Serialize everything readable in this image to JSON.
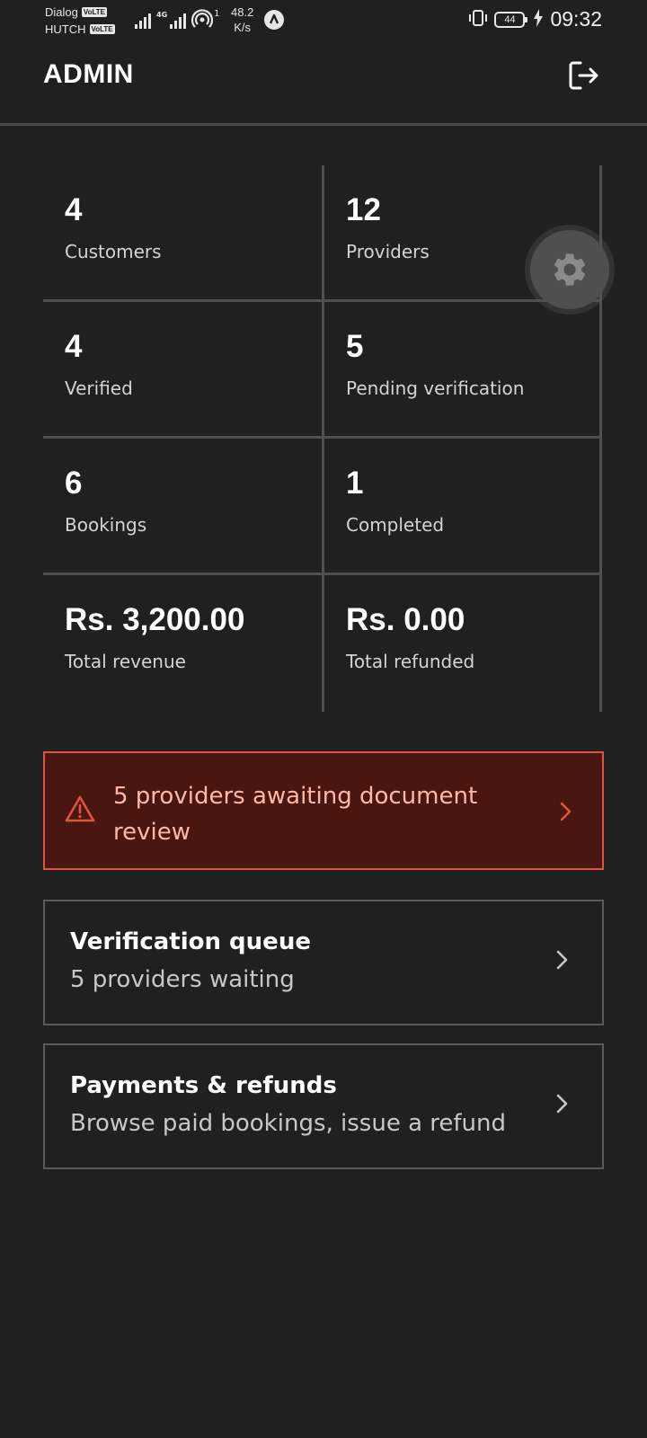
{
  "status_bar": {
    "carrier_1": "Dialog",
    "carrier_2": "HUTCH",
    "volte_badge": "VoLTE",
    "network_tag": "4G",
    "hotspot_count": "1",
    "speed_value": "48.2",
    "speed_unit": "K/s",
    "battery_level": "44",
    "time": "09:32"
  },
  "header": {
    "title": "ADMIN"
  },
  "stats": [
    {
      "value": "4",
      "label": "Customers"
    },
    {
      "value": "12",
      "label": "Providers"
    },
    {
      "value": "4",
      "label": "Verified"
    },
    {
      "value": "5",
      "label": "Pending verification"
    },
    {
      "value": "6",
      "label": "Bookings"
    },
    {
      "value": "1",
      "label": "Completed"
    },
    {
      "value": "Rs. 3,200.00",
      "label": "Total revenue"
    },
    {
      "value": "Rs. 0.00",
      "label": "Total refunded"
    }
  ],
  "alert": {
    "text": "5 providers awaiting document review",
    "color": "#e0533f",
    "background": "#4a1611"
  },
  "cards": [
    {
      "title": "Verification queue",
      "subtitle": "5 providers waiting"
    },
    {
      "title": "Payments & refunds",
      "subtitle": "Browse paid bookings, issue a refund"
    }
  ],
  "icons": {
    "logout": "logout-icon",
    "settings": "gear-icon",
    "warning": "warning-icon",
    "chevron": "chevron-right-icon"
  }
}
